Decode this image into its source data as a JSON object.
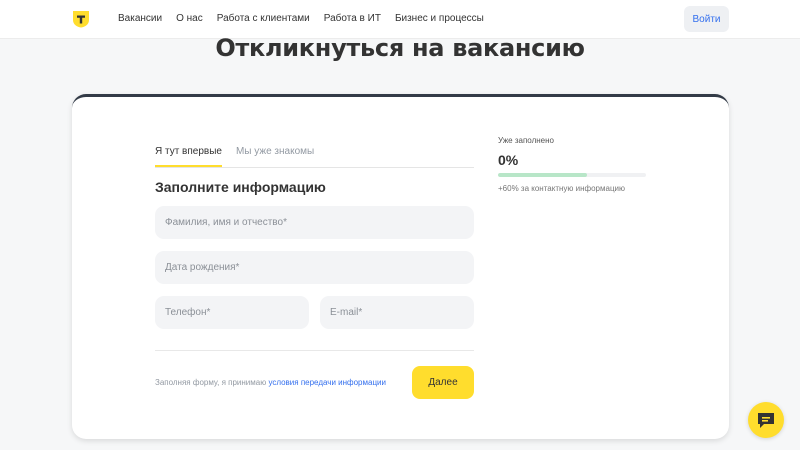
{
  "colors": {
    "accent": "#ffdd2d",
    "link": "#336fee",
    "progress_fill": "#b8e6c8",
    "card_top_border": "#333b47"
  },
  "header": {
    "nav": [
      "Вакансии",
      "О нас",
      "Работа с клиентами",
      "Работа в ИТ",
      "Бизнес и процессы"
    ],
    "login_label": "Войти"
  },
  "page": {
    "title": "Откликнуться на вакансию"
  },
  "form": {
    "tabs": [
      {
        "label": "Я тут впервые",
        "active": true
      },
      {
        "label": "Мы уже знакомы",
        "active": false
      }
    ],
    "section_title": "Заполните информацию",
    "fields": {
      "full_name": {
        "placeholder": "Фамилия, имя и отчество*",
        "value": ""
      },
      "birth_date": {
        "placeholder": "Дата рождения*",
        "value": ""
      },
      "phone": {
        "placeholder": "Телефон*",
        "value": ""
      },
      "email": {
        "placeholder": "E-mail*",
        "value": ""
      }
    },
    "consent_text": "Заполняя форму, я принимаю ",
    "consent_link": "условия передачи информации",
    "submit_label": "Далее"
  },
  "progress": {
    "label": "Уже заполнено",
    "value_text": "0%",
    "bar_fraction": 0.6,
    "hint": "+60% за контактную информацию"
  },
  "icons": {
    "logo": "bank-shield-logo",
    "chat": "chat-bubble-icon"
  }
}
